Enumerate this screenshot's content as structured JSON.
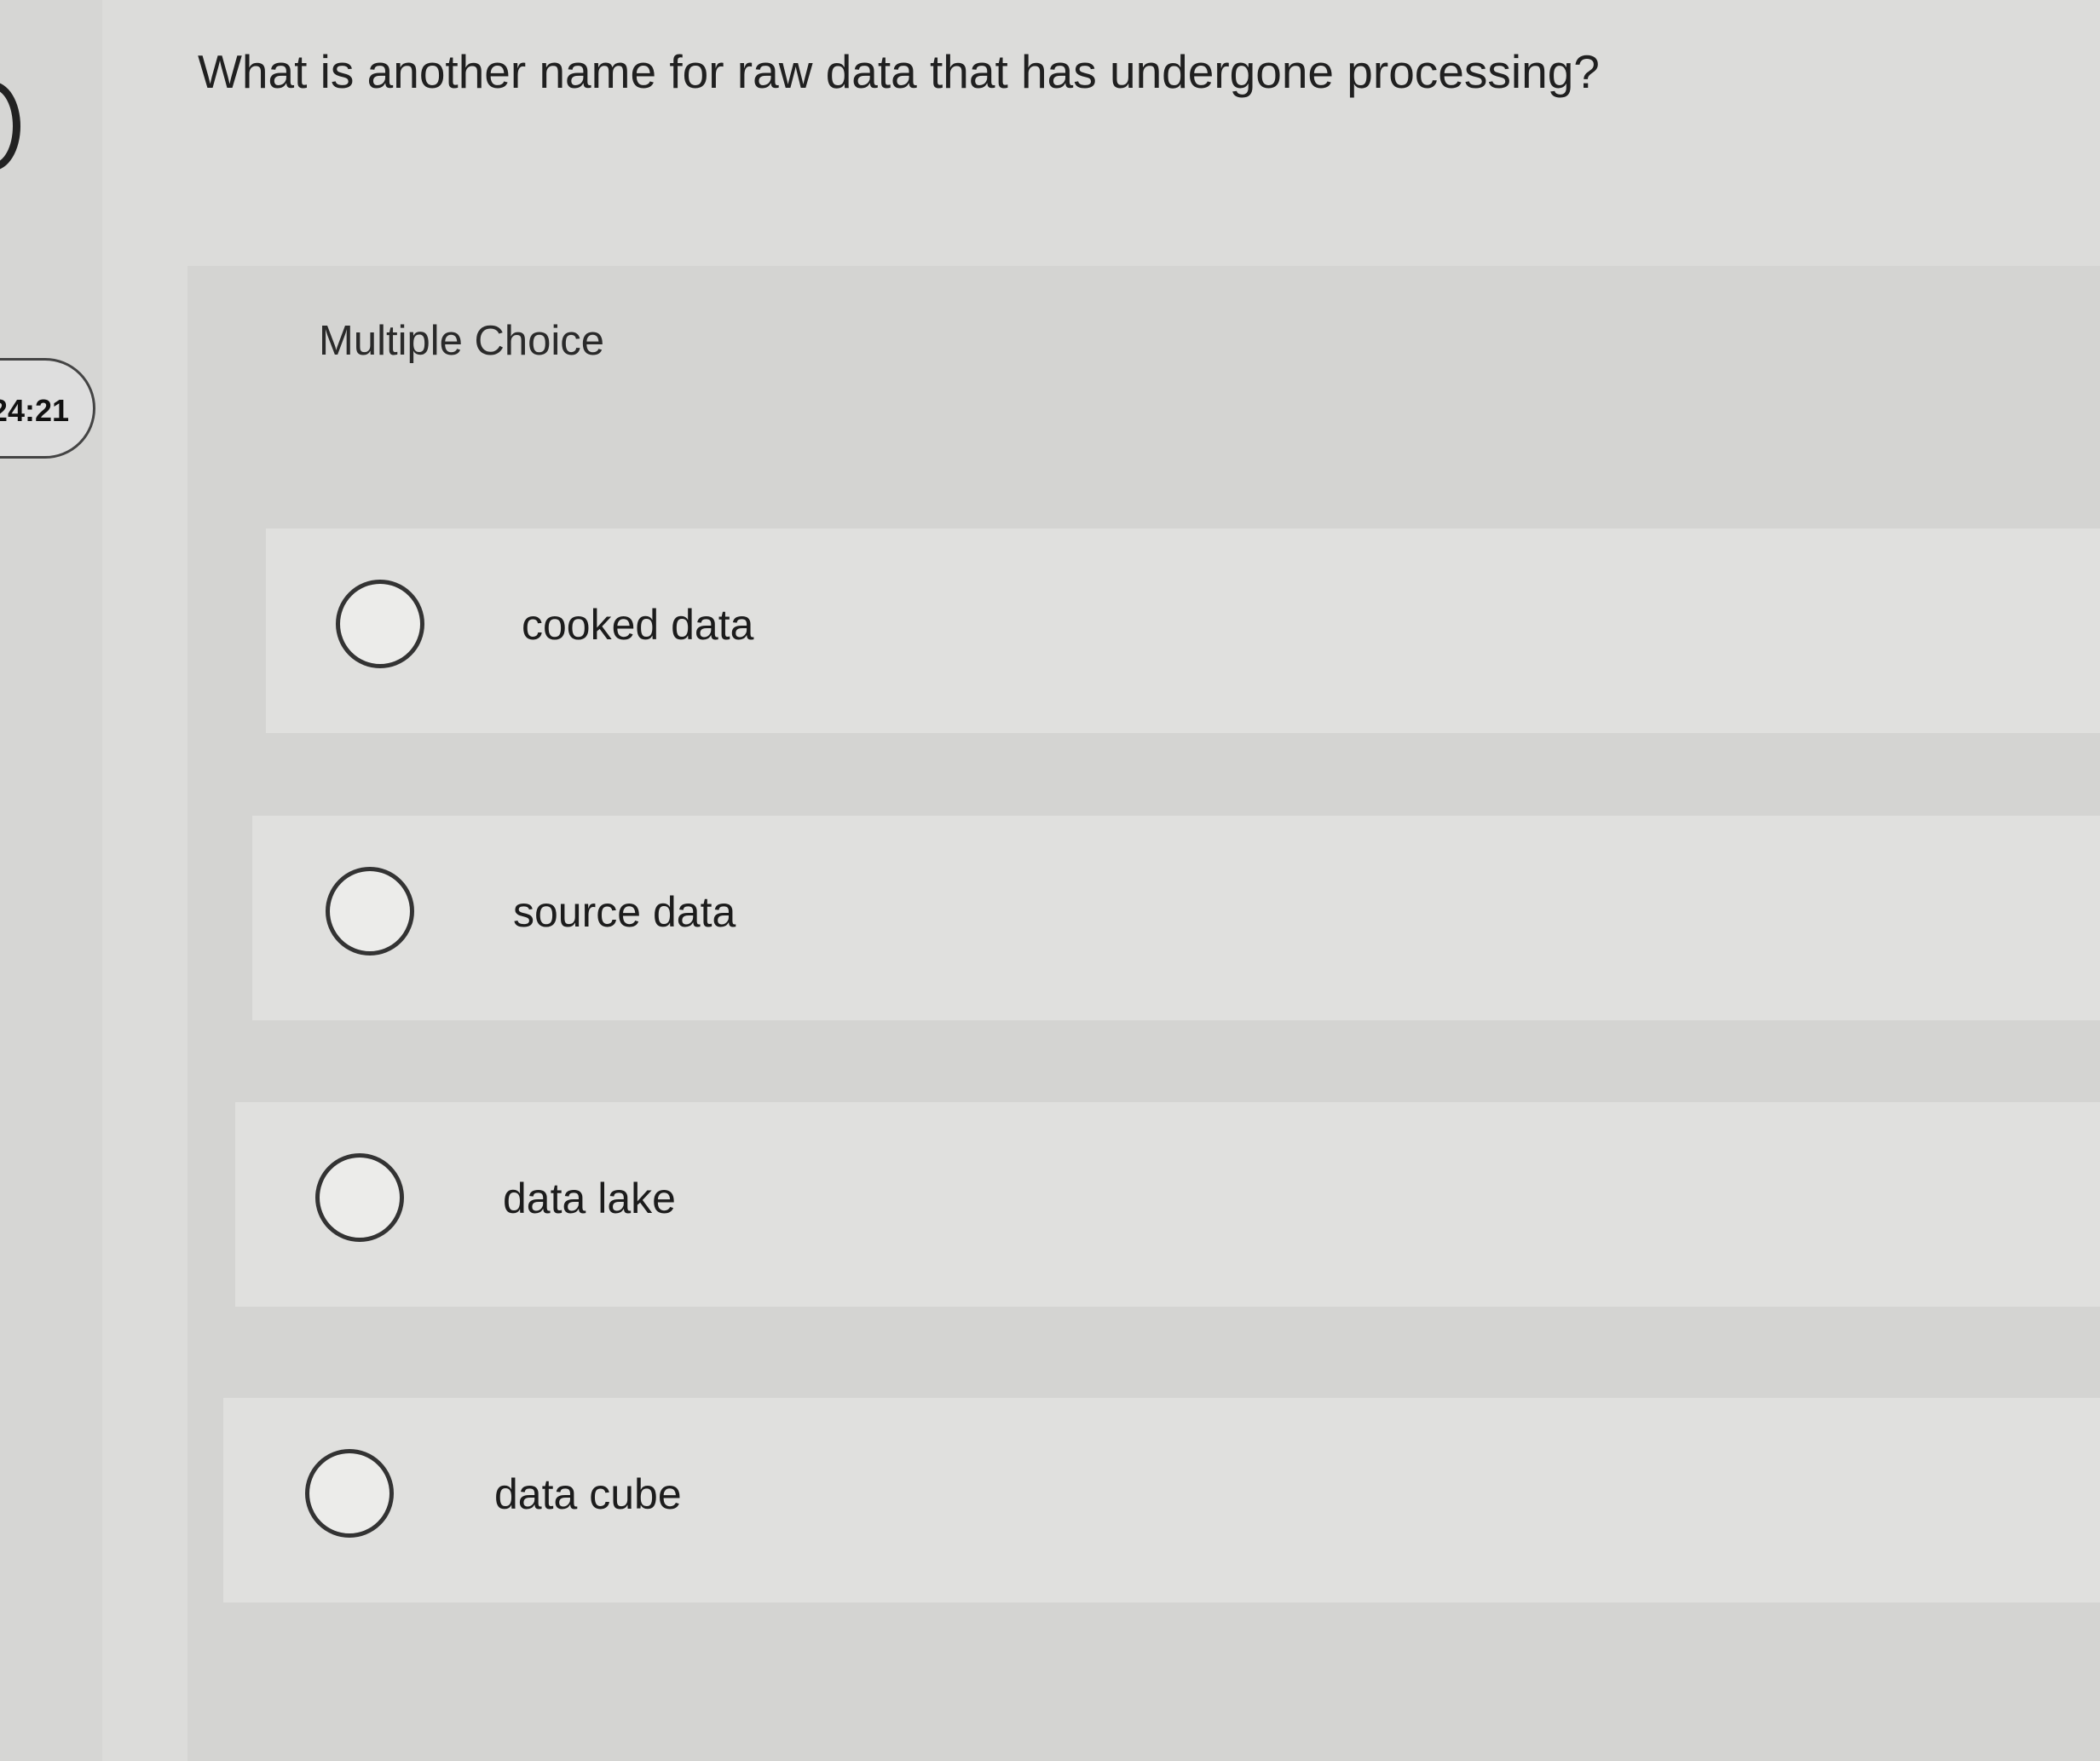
{
  "timer": {
    "text": "24:21"
  },
  "question": {
    "text": "What is another name for raw data that has undergone processing?",
    "type_label": "Multiple Choice"
  },
  "options": [
    {
      "label": "cooked data",
      "selected": false
    },
    {
      "label": "source data",
      "selected": false
    },
    {
      "label": "data lake",
      "selected": false
    },
    {
      "label": "data cube",
      "selected": false
    }
  ],
  "colors": {
    "page_background": "#dcdcda",
    "panel_background": "#d4d4d2",
    "option_background": "#e0e0de",
    "text": "#1e1e1e",
    "radio_border": "#333333"
  }
}
